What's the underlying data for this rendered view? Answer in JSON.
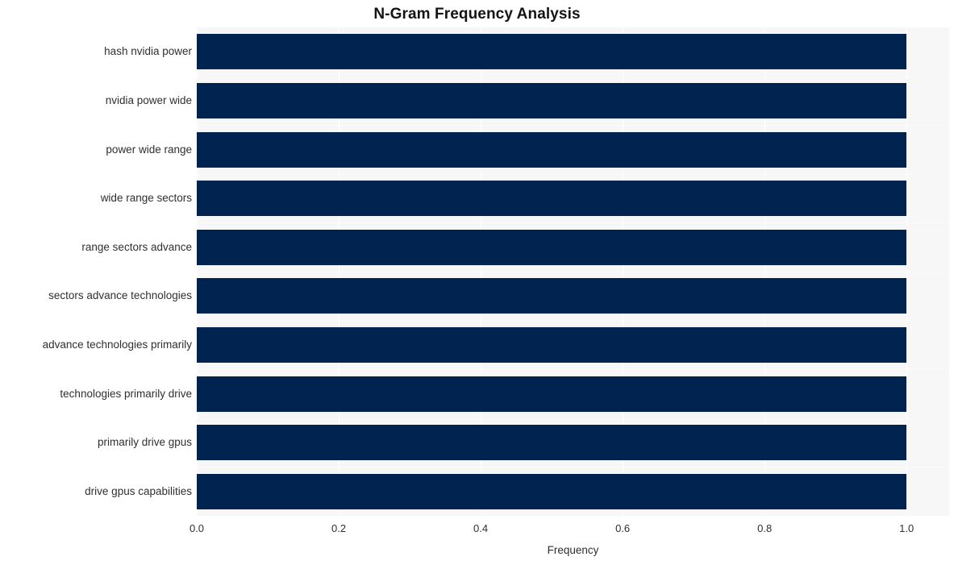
{
  "chart_data": {
    "type": "bar",
    "orientation": "horizontal",
    "title": "N-Gram Frequency Analysis",
    "xlabel": "Frequency",
    "ylabel": "",
    "categories": [
      "hash nvidia power",
      "nvidia power wide",
      "power wide range",
      "wide range sectors",
      "range sectors advance",
      "sectors advance technologies",
      "advance technologies primarily",
      "technologies primarily drive",
      "primarily drive gpus",
      "drive gpus capabilities"
    ],
    "values": [
      1.0,
      1.0,
      1.0,
      1.0,
      1.0,
      1.0,
      1.0,
      1.0,
      1.0,
      1.0
    ],
    "xlim": [
      0.0,
      1.06
    ],
    "xticks": [
      0.0,
      0.2,
      0.4,
      0.6,
      0.8,
      1.0
    ],
    "xtick_labels": [
      "0.0",
      "0.2",
      "0.4",
      "0.6",
      "0.8",
      "1.0"
    ],
    "grid": true,
    "legend": false,
    "bar_color": "#00234f",
    "plot_background": "#f7f7f8",
    "figure_background": "#ffffff",
    "gridline_color": "#ffffff",
    "text_color": "#2f2f2f",
    "title_color": "#141414"
  }
}
